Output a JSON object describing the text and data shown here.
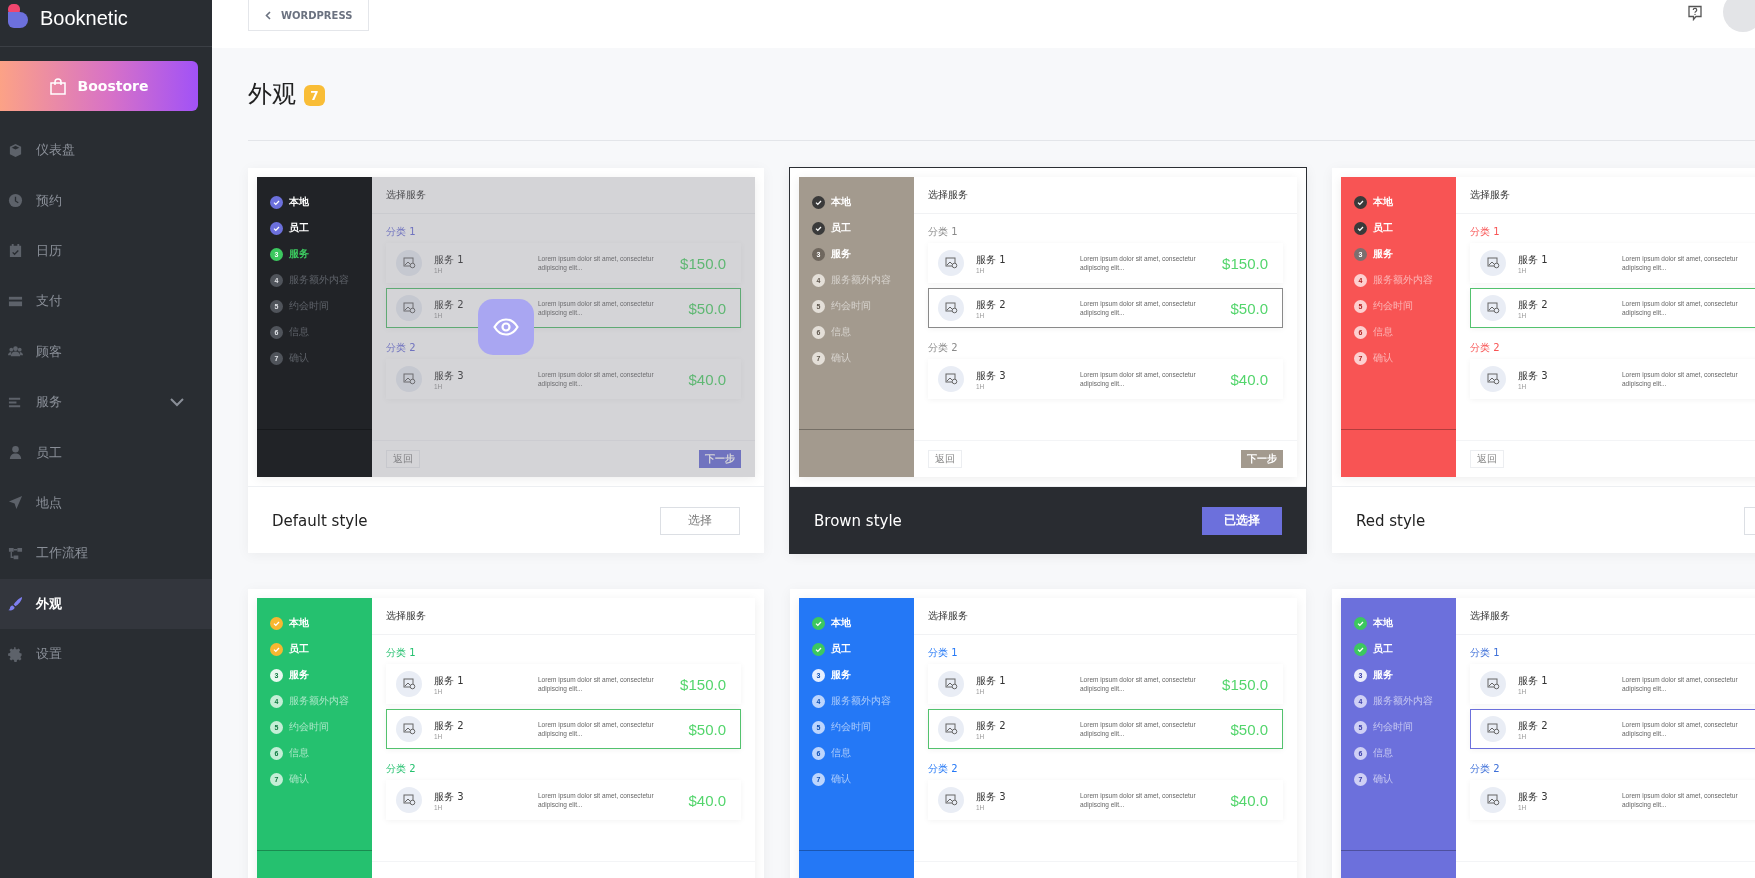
{
  "sidebar": {
    "logo": "Booknetic",
    "store_button": "Boostore",
    "items": [
      {
        "label": "仪表盘",
        "selected": false
      },
      {
        "label": "预约",
        "selected": false
      },
      {
        "label": "日历",
        "selected": false
      },
      {
        "label": "支付",
        "selected": false
      },
      {
        "label": "顾客",
        "selected": false
      },
      {
        "label": "服务",
        "selected": false,
        "expanded": false
      },
      {
        "label": "员工",
        "selected": false
      },
      {
        "label": "地点",
        "selected": false
      },
      {
        "label": "工作流程",
        "selected": false
      },
      {
        "label": "外观",
        "selected": true
      },
      {
        "label": "设置",
        "selected": false
      }
    ]
  },
  "topbar": {
    "back_button": "WORDPRESS"
  },
  "page": {
    "title": "外观",
    "count": "7"
  },
  "styles": [
    {
      "kind": "default",
      "name": "Default style",
      "color": "#212327",
      "selected": false,
      "hovered": true,
      "button": "选择",
      "preview": {
        "header": "选择服务",
        "back_button": "返回",
        "next_button": "下一步",
        "steps": [
          {
            "label": "本地",
            "kind": "done"
          },
          {
            "label": "员工",
            "kind": "done"
          },
          {
            "label": "服务",
            "kind": "current",
            "number": "3"
          },
          {
            "label": "服务额外内容",
            "kind": "pending",
            "number": "4"
          },
          {
            "label": "约会时间",
            "kind": "pending",
            "number": "5"
          },
          {
            "label": "信息",
            "kind": "pending",
            "number": "6"
          },
          {
            "label": "确认",
            "kind": "pending",
            "number": "7"
          }
        ],
        "categories": [
          {
            "label": "分类 1",
            "services": [
              {
                "name": "服务 1",
                "duration": "1H",
                "description": "Lorem ipsum dolor sit amet, consectetur adipiscing elit...",
                "price": "$150.0",
                "selected": false
              },
              {
                "name": "服务 2",
                "duration": "1H",
                "description": "Lorem ipsum dolor sit amet, consectetur adipiscing elit...",
                "price": "$50.0",
                "selected": true
              }
            ]
          },
          {
            "label": "分类 2",
            "services": [
              {
                "name": "服务 3",
                "duration": "1H",
                "description": "Lorem ipsum dolor sit amet, consectetur adipiscing elit...",
                "price": "$40.0",
                "selected": false
              }
            ]
          }
        ]
      }
    },
    {
      "kind": "brown",
      "name": "Brown style",
      "color": "#a39a8e",
      "selected": true,
      "hovered": false,
      "button": "已选择",
      "preview": {
        "header": "选择服务",
        "back_button": "返回",
        "next_button": "下一步",
        "steps": [
          {
            "label": "本地",
            "kind": "done"
          },
          {
            "label": "员工",
            "kind": "done"
          },
          {
            "label": "服务",
            "kind": "current",
            "number": "3"
          },
          {
            "label": "服务额外内容",
            "kind": "pending",
            "number": "4"
          },
          {
            "label": "约会时间",
            "kind": "pending",
            "number": "5"
          },
          {
            "label": "信息",
            "kind": "pending",
            "number": "6"
          },
          {
            "label": "确认",
            "kind": "pending",
            "number": "7"
          }
        ],
        "categories": [
          {
            "label": "分类 1",
            "services": [
              {
                "name": "服务 1",
                "duration": "1H",
                "description": "Lorem ipsum dolor sit amet, consectetur adipiscing elit...",
                "price": "$150.0",
                "selected": false
              },
              {
                "name": "服务 2",
                "duration": "1H",
                "description": "Lorem ipsum dolor sit amet, consectetur adipiscing elit...",
                "price": "$50.0",
                "selected": true
              }
            ]
          },
          {
            "label": "分类 2",
            "services": [
              {
                "name": "服务 3",
                "duration": "1H",
                "description": "Lorem ipsum dolor sit amet, consectetur adipiscing elit...",
                "price": "$40.0",
                "selected": false
              }
            ]
          }
        ]
      }
    },
    {
      "kind": "red",
      "name": "Red style",
      "color": "#f85454",
      "selected": false,
      "hovered": false,
      "preview": {
        "header": "选择服务",
        "back_button": "返回",
        "steps": [
          {
            "label": "本地",
            "kind": "done"
          },
          {
            "label": "员工",
            "kind": "done"
          },
          {
            "label": "服务",
            "kind": "current",
            "number": "3"
          },
          {
            "label": "服务额外内容",
            "kind": "pending",
            "number": "4"
          },
          {
            "label": "约会时间",
            "kind": "pending",
            "number": "5"
          },
          {
            "label": "信息",
            "kind": "pending",
            "number": "6"
          },
          {
            "label": "确认",
            "kind": "pending",
            "number": "7"
          }
        ],
        "categories": [
          {
            "label": "分类 1",
            "services": [
              {
                "name": "服务 1",
                "duration": "1H",
                "description": "Lorem ipsum dolor sit amet, consectetur adipiscing elit...",
                "selected": false
              },
              {
                "name": "服务 2",
                "duration": "1H",
                "description": "Lorem ipsum dolor sit amet, consectetur adipiscing elit...",
                "selected": true
              }
            ]
          },
          {
            "label": "分类 2",
            "services": [
              {
                "name": "服务 3",
                "duration": "1H",
                "description": "Lorem ipsum dolor sit amet, consectetur adipiscing elit...",
                "selected": false
              }
            ]
          }
        ]
      }
    },
    {
      "kind": "green",
      "color": "#25c16f",
      "selected": false,
      "hovered": false,
      "preview": {
        "header": "选择服务",
        "steps": [
          {
            "label": "本地",
            "kind": "done"
          },
          {
            "label": "员工",
            "kind": "done"
          },
          {
            "label": "服务",
            "kind": "current",
            "number": "3"
          },
          {
            "label": "服务额外内容",
            "kind": "pending",
            "number": "4"
          },
          {
            "label": "约会时间",
            "kind": "pending",
            "number": "5"
          },
          {
            "label": "信息",
            "kind": "pending",
            "number": "6"
          },
          {
            "label": "确认",
            "kind": "pending",
            "number": "7"
          }
        ],
        "categories": [
          {
            "label": "分类 1",
            "services": [
              {
                "name": "服务 1",
                "duration": "1H",
                "description": "Lorem ipsum dolor sit amet, consectetur adipiscing elit...",
                "price": "$150.0",
                "selected": false
              },
              {
                "name": "服务 2",
                "duration": "1H",
                "description": "Lorem ipsum dolor sit amet, consectetur adipiscing elit...",
                "price": "$50.0",
                "selected": true
              }
            ]
          },
          {
            "label": "分类 2",
            "services": [
              {
                "name": "服务 3",
                "duration": "1H",
                "description": "Lorem ipsum dolor sit amet, consectetur adipiscing elit...",
                "price": "$40.0",
                "selected": false
              }
            ]
          }
        ]
      }
    },
    {
      "kind": "blue",
      "color": "#2478f6",
      "selected": false,
      "hovered": false,
      "preview": {
        "header": "选择服务",
        "steps": [
          {
            "label": "本地",
            "kind": "done"
          },
          {
            "label": "员工",
            "kind": "done"
          },
          {
            "label": "服务",
            "kind": "current",
            "number": "3"
          },
          {
            "label": "服务额外内容",
            "kind": "pending",
            "number": "4"
          },
          {
            "label": "约会时间",
            "kind": "pending",
            "number": "5"
          },
          {
            "label": "信息",
            "kind": "pending",
            "number": "6"
          },
          {
            "label": "确认",
            "kind": "pending",
            "number": "7"
          }
        ],
        "categories": [
          {
            "label": "分类 1",
            "services": [
              {
                "name": "服务 1",
                "duration": "1H",
                "description": "Lorem ipsum dolor sit amet, consectetur adipiscing elit...",
                "price": "$150.0",
                "selected": false
              },
              {
                "name": "服务 2",
                "duration": "1H",
                "description": "Lorem ipsum dolor sit amet, consectetur adipiscing elit...",
                "price": "$50.0",
                "selected": true
              }
            ]
          },
          {
            "label": "分类 2",
            "services": [
              {
                "name": "服务 3",
                "duration": "1H",
                "description": "Lorem ipsum dolor sit amet, consectetur adipiscing elit...",
                "price": "$40.0",
                "selected": false
              }
            ]
          }
        ]
      }
    },
    {
      "kind": "purple",
      "color": "#6c70dc",
      "selected": false,
      "hovered": false,
      "preview": {
        "header": "选择服务",
        "steps": [
          {
            "label": "本地",
            "kind": "done"
          },
          {
            "label": "员工",
            "kind": "done"
          },
          {
            "label": "服务",
            "kind": "current",
            "number": "3"
          },
          {
            "label": "服务额外内容",
            "kind": "pending",
            "number": "4"
          },
          {
            "label": "约会时间",
            "kind": "pending",
            "number": "5"
          },
          {
            "label": "信息",
            "kind": "pending",
            "number": "6"
          },
          {
            "label": "确认",
            "kind": "pending",
            "number": "7"
          }
        ],
        "categories": [
          {
            "label": "分类 1",
            "services": [
              {
                "name": "服务 1",
                "duration": "1H",
                "description": "Lorem ipsum dolor sit amet, consectetur adipiscing elit...",
                "selected": false
              },
              {
                "name": "服务 2",
                "duration": "1H",
                "description": "Lorem ipsum dolor sit amet, consectetur adipiscing elit...",
                "selected": true
              }
            ]
          },
          {
            "label": "分类 2",
            "services": [
              {
                "name": "服务 3",
                "duration": "1H",
                "description": "Lorem ipsum dolor sit amet, consectetur adipiscing elit...",
                "selected": false
              }
            ]
          }
        ]
      }
    }
  ]
}
